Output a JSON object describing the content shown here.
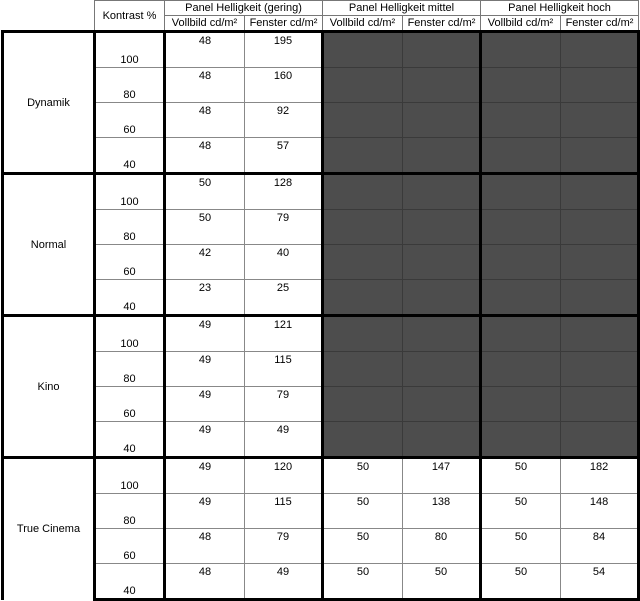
{
  "table": {
    "corner_label": "",
    "kontrast_header": "Kontrast %",
    "groups": [
      {
        "label": "Panel Helligkeit (gering)",
        "sub": [
          "Vollbild cd/m²",
          "Fenster cd/m²"
        ]
      },
      {
        "label": "Panel Helligkeit mittel",
        "sub": [
          "Vollbild cd/m²",
          "Fenster cd/m²"
        ]
      },
      {
        "label": "Panel Helligkeit hoch",
        "sub": [
          "Vollbild cd/m²",
          "Fenster cd/m²"
        ]
      }
    ],
    "sections": [
      {
        "mode": "Dynamik",
        "rows": [
          {
            "kontrast": "100",
            "values": [
              "48",
              "195",
              "",
              "",
              "",
              ""
            ]
          },
          {
            "kontrast": "80",
            "values": [
              "48",
              "160",
              "",
              "",
              "",
              ""
            ]
          },
          {
            "kontrast": "60",
            "values": [
              "48",
              "92",
              "",
              "",
              "",
              ""
            ]
          },
          {
            "kontrast": "40",
            "values": [
              "48",
              "57",
              "",
              "",
              "",
              ""
            ]
          }
        ]
      },
      {
        "mode": "Normal",
        "rows": [
          {
            "kontrast": "100",
            "values": [
              "50",
              "128",
              "",
              "",
              "",
              ""
            ]
          },
          {
            "kontrast": "80",
            "values": [
              "50",
              "79",
              "",
              "",
              "",
              ""
            ]
          },
          {
            "kontrast": "60",
            "values": [
              "42",
              "40",
              "",
              "",
              "",
              ""
            ]
          },
          {
            "kontrast": "40",
            "values": [
              "23",
              "25",
              "",
              "",
              "",
              ""
            ]
          }
        ]
      },
      {
        "mode": "Kino",
        "rows": [
          {
            "kontrast": "100",
            "values": [
              "49",
              "121",
              "",
              "",
              "",
              ""
            ]
          },
          {
            "kontrast": "80",
            "values": [
              "49",
              "115",
              "",
              "",
              "",
              ""
            ]
          },
          {
            "kontrast": "60",
            "values": [
              "49",
              "79",
              "",
              "",
              "",
              ""
            ]
          },
          {
            "kontrast": "40",
            "values": [
              "49",
              "49",
              "",
              "",
              "",
              ""
            ]
          }
        ]
      },
      {
        "mode": "True Cinema",
        "rows": [
          {
            "kontrast": "100",
            "values": [
              "49",
              "120",
              "50",
              "147",
              "50",
              "182"
            ]
          },
          {
            "kontrast": "80",
            "values": [
              "49",
              "115",
              "50",
              "138",
              "50",
              "148"
            ]
          },
          {
            "kontrast": "60",
            "values": [
              "48",
              "79",
              "50",
              "80",
              "50",
              "84"
            ]
          },
          {
            "kontrast": "40",
            "values": [
              "48",
              "49",
              "50",
              "50",
              "50",
              "54"
            ]
          }
        ]
      }
    ],
    "colors": {
      "blank_fill": "#4d4d4d",
      "rule_heavy": "#000000",
      "rule_light": "#888888",
      "background": "#ffffff"
    }
  },
  "watermark": {
    "text": ""
  }
}
